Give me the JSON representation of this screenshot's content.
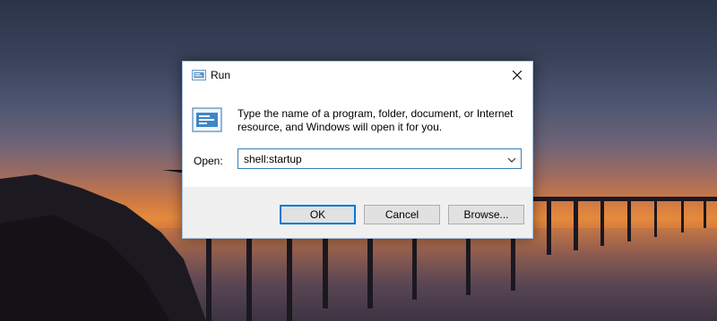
{
  "dialog": {
    "title": "Run",
    "description": "Type the name of a program, folder, document, or Internet resource, and Windows will open it for you.",
    "open_label": "Open:",
    "open_value": "shell:startup",
    "buttons": {
      "ok": "OK",
      "cancel": "Cancel",
      "browse": "Browse..."
    }
  },
  "icons": {
    "title": "run-icon",
    "body": "run-icon-large",
    "close": "close-icon",
    "dropdown": "chevron-down-icon"
  },
  "colors": {
    "accent": "#0078d7",
    "window_border": "#a9c6e8",
    "footer_bg": "#f0f0f0",
    "button_bg": "#e1e1e1"
  }
}
